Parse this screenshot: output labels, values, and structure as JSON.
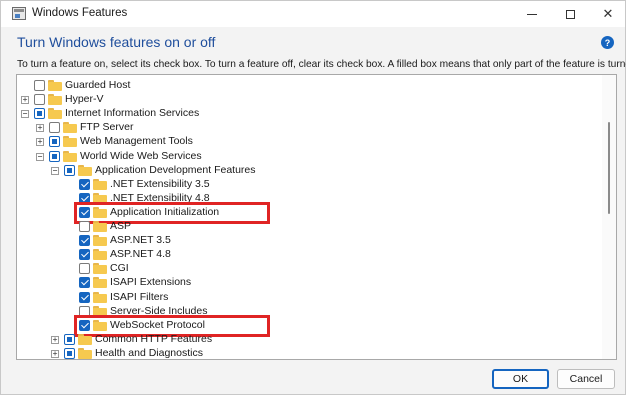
{
  "window": {
    "title": "Windows Features"
  },
  "heading": "Turn Windows features on or off",
  "description": "To turn a feature on, select its check box. To turn a feature off, clear its check box. A filled box means that only part of the feature is turned on.",
  "help_icon": "?",
  "tree": [
    {
      "label": "Guarded Host",
      "state": "unchecked",
      "expander": "none",
      "level": 0
    },
    {
      "label": "Hyper-V",
      "state": "unchecked",
      "expander": "+",
      "level": 0
    },
    {
      "label": "Internet Information Services",
      "state": "partial",
      "expander": "-",
      "level": 0
    },
    {
      "label": "FTP Server",
      "state": "unchecked",
      "expander": "+",
      "level": 1
    },
    {
      "label": "Web Management Tools",
      "state": "partial",
      "expander": "+",
      "level": 1
    },
    {
      "label": "World Wide Web Services",
      "state": "partial",
      "expander": "-",
      "level": 1
    },
    {
      "label": "Application Development Features",
      "state": "partial",
      "expander": "-",
      "level": 2
    },
    {
      "label": ".NET Extensibility 3.5",
      "state": "checked",
      "expander": "none",
      "level": 3
    },
    {
      "label": ".NET Extensibility 4.8",
      "state": "checked",
      "expander": "none",
      "level": 3
    },
    {
      "label": "Application Initialization",
      "state": "checked",
      "expander": "none",
      "level": 3
    },
    {
      "label": "ASP",
      "state": "unchecked",
      "expander": "none",
      "level": 3
    },
    {
      "label": "ASP.NET 3.5",
      "state": "checked",
      "expander": "none",
      "level": 3
    },
    {
      "label": "ASP.NET 4.8",
      "state": "checked",
      "expander": "none",
      "level": 3
    },
    {
      "label": "CGI",
      "state": "unchecked",
      "expander": "none",
      "level": 3
    },
    {
      "label": "ISAPI Extensions",
      "state": "checked",
      "expander": "none",
      "level": 3
    },
    {
      "label": "ISAPI Filters",
      "state": "checked",
      "expander": "none",
      "level": 3
    },
    {
      "label": "Server-Side Includes",
      "state": "unchecked",
      "expander": "none",
      "level": 3
    },
    {
      "label": "WebSocket Protocol",
      "state": "checked",
      "expander": "none",
      "level": 3
    },
    {
      "label": "Common HTTP Features",
      "state": "partial",
      "expander": "+",
      "level": 2
    },
    {
      "label": "Health and Diagnostics",
      "state": "partial",
      "expander": "+",
      "level": 2
    }
  ],
  "highlighted": [
    "Application Initialization",
    "WebSocket Protocol"
  ],
  "buttons": {
    "ok": "OK",
    "cancel": "Cancel"
  },
  "colors": {
    "accent": "#1565c0",
    "heading": "#1f4e9c",
    "highlight": "#e02424",
    "folder": "#f6c94f"
  }
}
